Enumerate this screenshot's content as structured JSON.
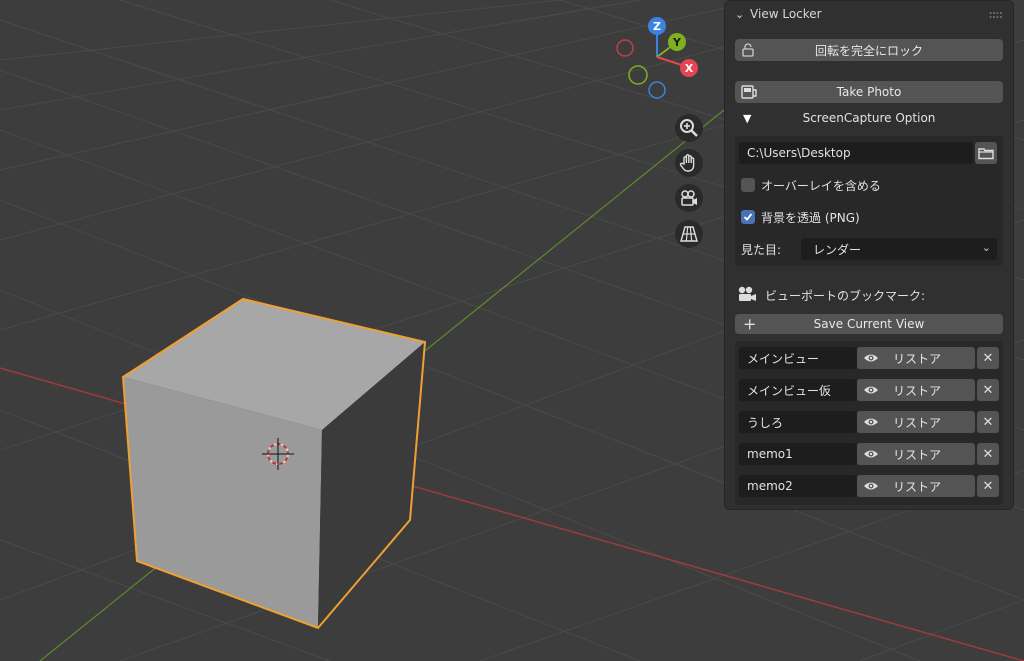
{
  "panel": {
    "title": "View Locker",
    "lock_label": "回転を完全にロック",
    "take_photo_label": "Take Photo",
    "screencapture_label": "ScreenCapture Option",
    "path_value": "C:\\Users\\Desktop",
    "overlay_label": "オーバーレイを含める",
    "overlay_checked": false,
    "transparent_label": "背景を透過 (PNG)",
    "transparent_checked": true,
    "look_label": "見た目:",
    "look_value": "レンダー",
    "bookmarks_label": "ビューポートのブックマーク:",
    "save_view_label": "Save Current View",
    "restore_label": "リストア",
    "bookmarks": [
      {
        "name": "メインビュー"
      },
      {
        "name": "メインビュー仮"
      },
      {
        "name": "うしろ"
      },
      {
        "name": "memo1"
      },
      {
        "name": "memo2"
      }
    ]
  },
  "gizmo": {
    "axes": [
      "X",
      "Y",
      "Z"
    ],
    "colors": {
      "x": "#e64553",
      "y": "#7fb020",
      "z": "#3a83e0"
    }
  },
  "icons": [
    "zoom-icon",
    "hand-icon",
    "camera-icon",
    "grid-icon",
    "lock-icon",
    "camera-photo-icon",
    "folder-icon",
    "eye-icon",
    "close-icon",
    "plus-icon",
    "movie-camera-icon"
  ]
}
